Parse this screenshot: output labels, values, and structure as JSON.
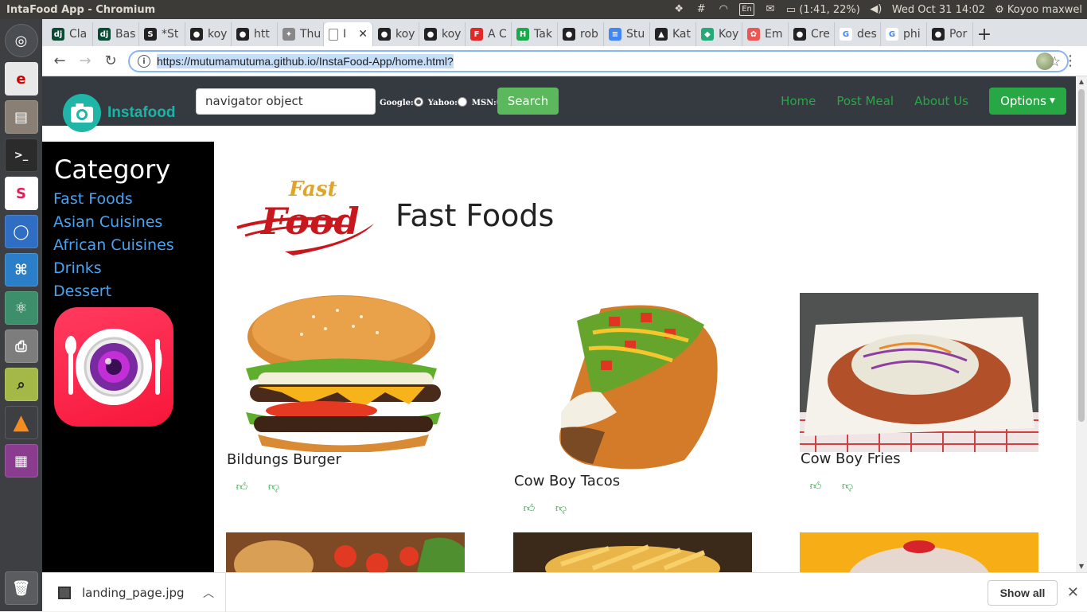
{
  "os_panel": {
    "window_title": "IntaFood App - Chromium",
    "keyboard_layout": "En",
    "battery": "(1:41, 22%)",
    "datetime": "Wed Oct 31 14:02",
    "user": "Koyoo maxwel"
  },
  "launcher": {
    "apps": [
      "ubuntu-dash",
      "ebook-reader",
      "files",
      "terminal",
      "slack",
      "chromium",
      "vscode",
      "atom",
      "scanner",
      "image-viewer",
      "vlc",
      "workspaces"
    ]
  },
  "browser": {
    "tabs": [
      {
        "label": "Cla",
        "icon": "django-icon",
        "color": "#0c4b33",
        "glyph": "dj"
      },
      {
        "label": "Bas",
        "icon": "django-icon",
        "color": "#0c4b33",
        "glyph": "dj"
      },
      {
        "label": "*St",
        "icon": "stackedit-icon",
        "color": "#222",
        "glyph": "S"
      },
      {
        "label": "koy",
        "icon": "github-icon",
        "color": "#222",
        "glyph": "●"
      },
      {
        "label": "htt",
        "icon": "github-icon",
        "color": "#222",
        "glyph": "●"
      },
      {
        "label": "Thu",
        "icon": "tree-icon",
        "color": "#888",
        "glyph": "✦"
      },
      {
        "label": "I",
        "icon": "page-icon",
        "color": "#fff",
        "glyph": "",
        "active": true
      },
      {
        "label": "koy",
        "icon": "github-icon",
        "color": "#222",
        "glyph": "●"
      },
      {
        "label": "koy",
        "icon": "github-icon",
        "color": "#222",
        "glyph": "●"
      },
      {
        "label": "A C",
        "icon": "flipboard-icon",
        "color": "#e12828",
        "glyph": "F"
      },
      {
        "label": "Tak",
        "icon": "hackerrank-icon",
        "color": "#1ba94c",
        "glyph": "H"
      },
      {
        "label": "rob",
        "icon": "github-icon",
        "color": "#222",
        "glyph": "●"
      },
      {
        "label": "Stu",
        "icon": "docs-icon",
        "color": "#4285f4",
        "glyph": "≡"
      },
      {
        "label": "Kat",
        "icon": "triangle-icon",
        "color": "#222",
        "glyph": "▲"
      },
      {
        "label": "Koy",
        "icon": "book-icon",
        "color": "#2a7",
        "glyph": "◆"
      },
      {
        "label": "Em",
        "icon": "puzzle-icon",
        "color": "#e55",
        "glyph": "✿"
      },
      {
        "label": "Cre",
        "icon": "github-icon",
        "color": "#222",
        "glyph": "●"
      },
      {
        "label": "des",
        "icon": "google-icon",
        "color": "#fff",
        "glyph": "G"
      },
      {
        "label": "phi",
        "icon": "google-icon",
        "color": "#fff",
        "glyph": "G"
      },
      {
        "label": "Por",
        "icon": "portfolio-icon",
        "color": "#222",
        "glyph": "●"
      }
    ],
    "url": "https://mutumamutuma.github.io/InstaFood-App/home.html?"
  },
  "site": {
    "brand": "Instafood",
    "search_value": "navigator object",
    "engines": [
      {
        "label": "Google:",
        "checked": true
      },
      {
        "label": "Yahoo:",
        "checked": false
      },
      {
        "label": "MSN:",
        "checked": false
      }
    ],
    "search_button": "Search",
    "nav": [
      "Home",
      "Post Meal",
      "About Us"
    ],
    "options_button": "Options"
  },
  "sidebar": {
    "title": "Category",
    "items": [
      "Fast Foods",
      "Asian Cuisines",
      "African Cuisines",
      "Drinks",
      "Dessert"
    ]
  },
  "section": {
    "logo_top": "Fast",
    "logo_bottom": "Food",
    "title": "Fast Foods"
  },
  "meals": [
    {
      "name": "Bildungs Burger",
      "image": "burger"
    },
    {
      "name": "Cow Boy Tacos",
      "image": "taco"
    },
    {
      "name": "Cow Boy Fries",
      "image": "loaded-fries"
    },
    {
      "image": "pizza"
    },
    {
      "image": "french-fries"
    },
    {
      "image": "donut"
    }
  ],
  "downloads": {
    "file": "landing_page.jpg",
    "show_all": "Show all"
  },
  "colors": {
    "navbar": "#343a40",
    "green": "#28a745",
    "teal": "#19b4a6",
    "sidebar_link": "#4aa3f0",
    "fastfood_red": "#c8181e"
  }
}
